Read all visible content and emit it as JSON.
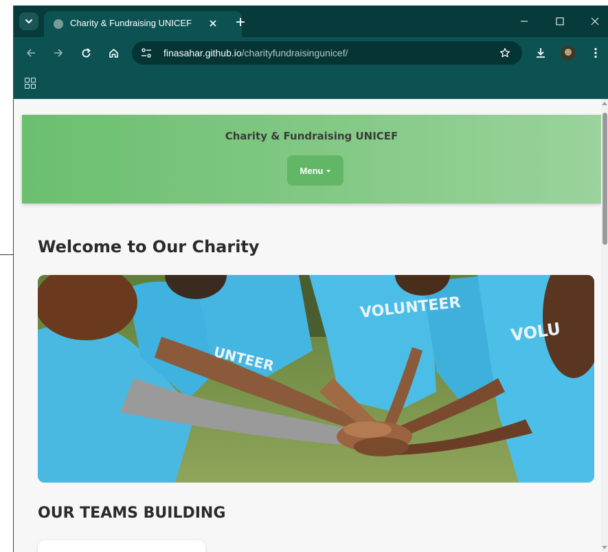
{
  "browser": {
    "tab_title": "Charity & Fundraising UNICEF",
    "url_host": "finasahar.github.io",
    "url_path": "/charityfundraisingunicef/"
  },
  "site": {
    "header_title": "Charity & Fundraising UNICEF",
    "menu_label": "Menu",
    "welcome_heading": "Welcome to Our Charity",
    "hero_shirt_texts": [
      "VOLUNTEER",
      "UNTEER",
      "VOLU"
    ],
    "teams_heading": "OUR TEAMS BUILDING"
  },
  "colors": {
    "browser_frame": "#073a3a",
    "toolbar": "#0d5252",
    "header_green": "#6bbf6f",
    "menu_button": "#62b766",
    "page_bg": "#f7f7f8",
    "shirt_blue": "#4cc1e8"
  },
  "icons": [
    "tab-search-icon",
    "globe-icon",
    "close-icon",
    "plus-icon",
    "minimize-icon",
    "maximize-icon",
    "window-close-icon",
    "back-icon",
    "forward-icon",
    "reload-icon",
    "home-icon",
    "site-settings-icon",
    "star-icon",
    "download-icon",
    "profile-icon",
    "kebab-menu-icon",
    "apps-icon",
    "caret-down-icon"
  ]
}
